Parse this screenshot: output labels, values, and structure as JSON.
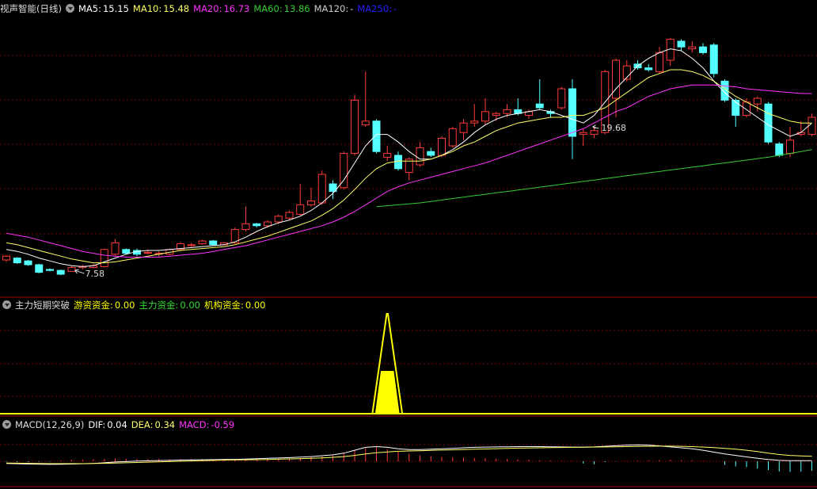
{
  "colors": {
    "up": "#ff3b3b",
    "down": "#54ffff",
    "ma5": "#ffffff",
    "ma10": "#ffff66",
    "ma20": "#ff33ff",
    "ma60": "#33cc33",
    "ma120": "#cccccc",
    "ma250": "#2222ff",
    "fund": "#ffff00",
    "grid": "#7a0000",
    "border": "#aa0000"
  },
  "panels": {
    "price": {
      "title": "视声智能(日线)",
      "labels": {
        "ma5": "MA5:",
        "ma10": "MA10:",
        "ma20": "MA20:",
        "ma60": "MA60:",
        "ma120": "MA120:",
        "ma250": "MA250:"
      },
      "values": {
        "ma5": "15.15",
        "ma10": "15.48",
        "ma20": "16.73",
        "ma60": "13.86",
        "ma120": "-",
        "ma250": "-"
      }
    },
    "fund": {
      "title": "主力短期突破",
      "labels": {
        "a": "游资资金:",
        "b": "主力资金:",
        "c": "机构资金:"
      },
      "values": {
        "a": "0.00",
        "b": "0.00",
        "c": "0.00"
      }
    },
    "macd": {
      "title": "MACD(12,26,9)",
      "labels": {
        "dif": "DIF:",
        "dea": "DEA:",
        "macd": "MACD:"
      },
      "values": {
        "dif": "0.04",
        "dea": "0.34",
        "macd": "-0.59"
      }
    }
  },
  "chart_data": [
    {
      "type": "candlestick",
      "ylim": [
        7.0,
        20.5
      ],
      "annotations": [
        {
          "text": "19.68",
          "at_index": 54
        },
        {
          "text": "7.58",
          "at_index": 6
        }
      ],
      "candles": [
        {
          "o": 8.0,
          "c": 8.2,
          "h": 8.25,
          "l": 7.9
        },
        {
          "o": 8.1,
          "c": 7.85,
          "h": 8.15,
          "l": 7.8
        },
        {
          "o": 7.95,
          "c": 7.75,
          "h": 8.0,
          "l": 7.7
        },
        {
          "o": 7.75,
          "c": 7.35,
          "h": 7.8,
          "l": 7.3
        },
        {
          "o": 7.5,
          "c": 7.45,
          "h": 7.55,
          "l": 7.4
        },
        {
          "o": 7.45,
          "c": 7.25,
          "h": 7.5,
          "l": 7.2
        },
        {
          "o": 7.4,
          "c": 7.6,
          "h": 7.7,
          "l": 7.58
        },
        {
          "o": 7.6,
          "c": 7.65,
          "h": 7.75,
          "l": 7.5
        },
        {
          "o": 7.6,
          "c": 7.7,
          "h": 7.8,
          "l": 7.55
        },
        {
          "o": 7.65,
          "c": 8.55,
          "h": 8.6,
          "l": 7.6
        },
        {
          "o": 8.3,
          "c": 8.9,
          "h": 9.1,
          "l": 8.2
        },
        {
          "o": 8.55,
          "c": 8.35,
          "h": 8.6,
          "l": 8.3
        },
        {
          "o": 8.5,
          "c": 8.3,
          "h": 8.6,
          "l": 8.2
        },
        {
          "o": 8.35,
          "c": 8.4,
          "h": 8.55,
          "l": 8.3
        },
        {
          "o": 8.3,
          "c": 8.35,
          "h": 8.45,
          "l": 8.2
        },
        {
          "o": 8.3,
          "c": 8.55,
          "h": 8.6,
          "l": 8.25
        },
        {
          "o": 8.55,
          "c": 8.85,
          "h": 8.95,
          "l": 8.5
        },
        {
          "o": 8.75,
          "c": 8.8,
          "h": 8.9,
          "l": 8.7
        },
        {
          "o": 8.85,
          "c": 9.0,
          "h": 9.05,
          "l": 8.8
        },
        {
          "o": 9.0,
          "c": 8.8,
          "h": 9.05,
          "l": 8.75
        },
        {
          "o": 8.8,
          "c": 8.9,
          "h": 8.95,
          "l": 8.75
        },
        {
          "o": 8.9,
          "c": 9.6,
          "h": 9.7,
          "l": 8.85
        },
        {
          "o": 9.6,
          "c": 9.9,
          "h": 10.8,
          "l": 9.5
        },
        {
          "o": 9.9,
          "c": 9.8,
          "h": 9.95,
          "l": 9.7
        },
        {
          "o": 9.8,
          "c": 10.0,
          "h": 10.1,
          "l": 9.7
        },
        {
          "o": 10.0,
          "c": 10.3,
          "h": 10.4,
          "l": 9.9
        },
        {
          "o": 10.2,
          "c": 10.5,
          "h": 10.6,
          "l": 10.1
        },
        {
          "o": 10.4,
          "c": 10.9,
          "h": 12.0,
          "l": 10.3
        },
        {
          "o": 10.9,
          "c": 11.1,
          "h": 11.8,
          "l": 10.8
        },
        {
          "o": 11.0,
          "c": 12.5,
          "h": 12.7,
          "l": 10.9
        },
        {
          "o": 12.0,
          "c": 11.6,
          "h": 12.2,
          "l": 11.2
        },
        {
          "o": 11.8,
          "c": 13.6,
          "h": 13.7,
          "l": 11.7
        },
        {
          "o": 13.6,
          "c": 16.4,
          "h": 16.7,
          "l": 13.5
        },
        {
          "o": 15.1,
          "c": 15.3,
          "h": 17.9,
          "l": 15.0
        },
        {
          "o": 15.3,
          "c": 13.7,
          "h": 15.4,
          "l": 13.6
        },
        {
          "o": 13.4,
          "c": 13.6,
          "h": 14.0,
          "l": 13.2
        },
        {
          "o": 13.5,
          "c": 12.8,
          "h": 13.7,
          "l": 12.7
        },
        {
          "o": 12.6,
          "c": 13.3,
          "h": 13.4,
          "l": 12.2
        },
        {
          "o": 13.0,
          "c": 13.9,
          "h": 14.2,
          "l": 12.9
        },
        {
          "o": 13.7,
          "c": 13.5,
          "h": 13.9,
          "l": 13.4
        },
        {
          "o": 13.5,
          "c": 14.4,
          "h": 14.5,
          "l": 13.4
        },
        {
          "o": 14.0,
          "c": 14.9,
          "h": 15.0,
          "l": 13.9
        },
        {
          "o": 14.7,
          "c": 15.2,
          "h": 15.4,
          "l": 14.3
        },
        {
          "o": 15.2,
          "c": 15.3,
          "h": 16.2,
          "l": 15.0
        },
        {
          "o": 15.3,
          "c": 15.8,
          "h": 16.5,
          "l": 15.1
        },
        {
          "o": 15.6,
          "c": 15.7,
          "h": 15.8,
          "l": 15.3
        },
        {
          "o": 15.7,
          "c": 15.9,
          "h": 16.2,
          "l": 15.5
        },
        {
          "o": 15.9,
          "c": 15.7,
          "h": 16.5,
          "l": 15.6
        },
        {
          "o": 15.6,
          "c": 15.8,
          "h": 15.9,
          "l": 15.4
        },
        {
          "o": 16.2,
          "c": 16.0,
          "h": 17.5,
          "l": 15.9
        },
        {
          "o": 15.8,
          "c": 15.7,
          "h": 15.9,
          "l": 15.5
        },
        {
          "o": 16.0,
          "c": 17.0,
          "h": 17.1,
          "l": 15.9
        },
        {
          "o": 17.0,
          "c": 14.5,
          "h": 17.5,
          "l": 13.3
        },
        {
          "o": 14.6,
          "c": 14.7,
          "h": 14.9,
          "l": 14.0
        },
        {
          "o": 14.6,
          "c": 14.8,
          "h": 15.0,
          "l": 14.4
        },
        {
          "o": 14.7,
          "c": 17.9,
          "h": 18.0,
          "l": 14.6
        },
        {
          "o": 16.5,
          "c": 18.5,
          "h": 18.6,
          "l": 15.5
        },
        {
          "o": 17.5,
          "c": 18.2,
          "h": 18.5,
          "l": 17.4
        },
        {
          "o": 18.3,
          "c": 18.1,
          "h": 18.5,
          "l": 18.0
        },
        {
          "o": 18.1,
          "c": 18.0,
          "h": 18.3,
          "l": 17.9
        },
        {
          "o": 17.9,
          "c": 18.9,
          "h": 19.2,
          "l": 17.8
        },
        {
          "o": 18.5,
          "c": 19.6,
          "h": 19.68,
          "l": 18.2
        },
        {
          "o": 19.5,
          "c": 19.2,
          "h": 19.6,
          "l": 19.0
        },
        {
          "o": 19.1,
          "c": 19.2,
          "h": 19.5,
          "l": 18.9
        },
        {
          "o": 19.2,
          "c": 18.9,
          "h": 19.4,
          "l": 18.8
        },
        {
          "o": 19.3,
          "c": 17.8,
          "h": 19.4,
          "l": 17.6
        },
        {
          "o": 17.4,
          "c": 16.4,
          "h": 17.5,
          "l": 16.3
        },
        {
          "o": 16.4,
          "c": 15.6,
          "h": 16.5,
          "l": 15.0
        },
        {
          "o": 15.6,
          "c": 16.3,
          "h": 16.5,
          "l": 15.5
        },
        {
          "o": 16.2,
          "c": 16.5,
          "h": 16.6,
          "l": 15.8
        },
        {
          "o": 16.2,
          "c": 14.2,
          "h": 16.3,
          "l": 14.1
        },
        {
          "o": 14.1,
          "c": 13.5,
          "h": 14.2,
          "l": 13.4
        },
        {
          "o": 13.6,
          "c": 14.3,
          "h": 15.0,
          "l": 13.4
        },
        {
          "o": 14.6,
          "c": 14.7,
          "h": 15.3,
          "l": 14.5
        },
        {
          "o": 14.6,
          "c": 15.5,
          "h": 15.7,
          "l": 14.5
        },
        {
          "o": 15.5,
          "c": 16.2,
          "h": 16.8,
          "l": 15.4
        }
      ],
      "series": [
        {
          "name": "MA5",
          "key": "ma5",
          "values": [
            8.55,
            8.45,
            8.3,
            8.1,
            7.95,
            7.8,
            7.7,
            7.65,
            7.7,
            7.9,
            8.1,
            8.3,
            8.45,
            8.5,
            8.5,
            8.55,
            8.6,
            8.65,
            8.7,
            8.75,
            8.8,
            8.95,
            9.2,
            9.5,
            9.75,
            9.95,
            10.1,
            10.3,
            10.6,
            11.0,
            11.5,
            12.2,
            13.1,
            14.0,
            14.6,
            14.6,
            14.2,
            13.7,
            13.3,
            13.3,
            13.5,
            13.8,
            14.2,
            14.7,
            15.1,
            15.4,
            15.6,
            15.7,
            15.8,
            15.9,
            15.8,
            15.6,
            15.4,
            15.2,
            15.6,
            16.3,
            17.0,
            17.6,
            18.2,
            18.6,
            18.9,
            19.1,
            19.0,
            18.6,
            18.1,
            17.4,
            16.8,
            16.3,
            15.9,
            15.5,
            15.1,
            14.8,
            14.5,
            14.7,
            15.2
          ]
        },
        {
          "name": "MA10",
          "key": "ma10",
          "values": [
            8.9,
            8.8,
            8.65,
            8.5,
            8.35,
            8.2,
            8.05,
            7.95,
            7.85,
            7.85,
            7.9,
            8.0,
            8.1,
            8.2,
            8.3,
            8.4,
            8.5,
            8.55,
            8.6,
            8.65,
            8.7,
            8.8,
            8.95,
            9.1,
            9.25,
            9.45,
            9.65,
            9.85,
            10.05,
            10.35,
            10.7,
            11.15,
            11.7,
            12.3,
            12.8,
            13.1,
            13.2,
            13.2,
            13.2,
            13.3,
            13.5,
            13.7,
            14.0,
            14.2,
            14.5,
            14.8,
            15.0,
            15.2,
            15.3,
            15.4,
            15.5,
            15.5,
            15.6,
            15.6,
            15.8,
            16.0,
            16.4,
            16.8,
            17.2,
            17.6,
            17.8,
            18.0,
            18.0,
            17.9,
            17.7,
            17.4,
            17.0,
            16.6,
            16.3,
            16.0,
            15.7,
            15.5,
            15.3,
            15.2,
            15.2
          ]
        },
        {
          "name": "MA20",
          "key": "ma20",
          "values": [
            9.4,
            9.3,
            9.2,
            9.05,
            8.9,
            8.75,
            8.6,
            8.45,
            8.35,
            8.25,
            8.2,
            8.15,
            8.15,
            8.15,
            8.15,
            8.2,
            8.25,
            8.3,
            8.35,
            8.45,
            8.55,
            8.65,
            8.75,
            8.9,
            9.05,
            9.2,
            9.35,
            9.5,
            9.65,
            9.8,
            10.0,
            10.25,
            10.55,
            10.9,
            11.25,
            11.6,
            11.85,
            12.05,
            12.2,
            12.35,
            12.5,
            12.65,
            12.8,
            12.95,
            13.1,
            13.3,
            13.5,
            13.7,
            13.9,
            14.1,
            14.3,
            14.5,
            14.7,
            14.9,
            15.2,
            15.5,
            15.8,
            16.0,
            16.3,
            16.6,
            16.8,
            17.0,
            17.1,
            17.2,
            17.2,
            17.2,
            17.15,
            17.1,
            17.0,
            16.95,
            16.9,
            16.85,
            16.8,
            16.75,
            16.75
          ]
        },
        {
          "name": "MA60",
          "key": "ma60",
          "start": 34,
          "values": [
            10.8,
            10.85,
            10.9,
            10.95,
            11.0,
            11.07,
            11.15,
            11.23,
            11.3,
            11.38,
            11.45,
            11.53,
            11.6,
            11.68,
            11.75,
            11.83,
            11.9,
            11.98,
            12.05,
            12.13,
            12.2,
            12.28,
            12.35,
            12.43,
            12.5,
            12.58,
            12.65,
            12.73,
            12.8,
            12.88,
            12.95,
            13.03,
            13.1,
            13.18,
            13.25,
            13.33,
            13.4,
            13.5,
            13.6,
            13.7,
            13.8
          ]
        }
      ]
    },
    {
      "type": "area",
      "series_name": "主力短期突破",
      "ylim": [
        0,
        1
      ],
      "bar": {
        "start_index": 34,
        "end_index": 36,
        "outer": 1.0,
        "inner": 0.42
      }
    },
    {
      "type": "bar",
      "ylim": [
        -1.1,
        2.0
      ],
      "hist": [
        -0.05,
        -0.06,
        -0.05,
        -0.04,
        -0.03,
        0.05,
        0.1,
        0.12,
        0.14,
        0.16,
        0.18,
        0.17,
        0.16,
        0.15,
        0.14,
        0.14,
        0.15,
        0.15,
        0.14,
        0.13,
        0.12,
        0.12,
        0.14,
        0.15,
        0.15,
        0.16,
        0.18,
        0.22,
        0.28,
        0.34,
        0.4,
        0.55,
        0.75,
        0.9,
        0.95,
        0.82,
        0.65,
        0.5,
        0.4,
        0.35,
        0.3,
        0.28,
        0.25,
        0.22,
        0.2,
        0.18,
        0.15,
        0.12,
        0.1,
        0.08,
        0.05,
        0.03,
        0.02,
        -0.15,
        -0.2,
        -0.06,
        -0.02,
        0.02,
        0.05,
        0.07,
        0.08,
        0.09,
        0.08,
        0.07,
        0.03,
        0.0,
        -0.25,
        -0.35,
        -0.4,
        -0.5,
        -0.6,
        -0.7,
        -0.72,
        -0.7,
        -0.65
      ],
      "dif": [
        -0.15,
        -0.17,
        -0.19,
        -0.2,
        -0.21,
        -0.2,
        -0.19,
        -0.17,
        -0.15,
        -0.1,
        -0.05,
        -0.02,
        0.01,
        0.03,
        0.05,
        0.06,
        0.08,
        0.09,
        0.1,
        0.11,
        0.12,
        0.13,
        0.15,
        0.18,
        0.2,
        0.22,
        0.25,
        0.28,
        0.32,
        0.38,
        0.44,
        0.55,
        0.75,
        0.95,
        1.0,
        0.95,
        0.85,
        0.8,
        0.8,
        0.82,
        0.85,
        0.88,
        0.92,
        0.95,
        0.97,
        0.98,
        0.99,
        1.0,
        1.0,
        1.0,
        0.99,
        0.98,
        0.97,
        0.96,
        0.98,
        1.02,
        1.06,
        1.1,
        1.12,
        1.1,
        1.05,
        0.98,
        0.92,
        0.85,
        0.75,
        0.62,
        0.5,
        0.4,
        0.3,
        0.2,
        0.12,
        0.06,
        0.04,
        0.04,
        0.04
      ],
      "dea": [
        -0.12,
        -0.13,
        -0.14,
        -0.15,
        -0.16,
        -0.16,
        -0.16,
        -0.16,
        -0.15,
        -0.14,
        -0.12,
        -0.1,
        -0.08,
        -0.06,
        -0.04,
        -0.02,
        0.0,
        0.02,
        0.04,
        0.06,
        0.08,
        0.09,
        0.1,
        0.11,
        0.12,
        0.14,
        0.16,
        0.18,
        0.2,
        0.23,
        0.27,
        0.32,
        0.4,
        0.5,
        0.58,
        0.64,
        0.68,
        0.7,
        0.72,
        0.74,
        0.76,
        0.78,
        0.8,
        0.82,
        0.84,
        0.86,
        0.88,
        0.9,
        0.91,
        0.92,
        0.93,
        0.94,
        0.95,
        0.96,
        0.97,
        0.98,
        0.99,
        1.0,
        1.01,
        1.02,
        1.03,
        1.03,
        1.02,
        1.0,
        0.97,
        0.93,
        0.88,
        0.82,
        0.75,
        0.66,
        0.55,
        0.46,
        0.4,
        0.36,
        0.34
      ]
    }
  ]
}
